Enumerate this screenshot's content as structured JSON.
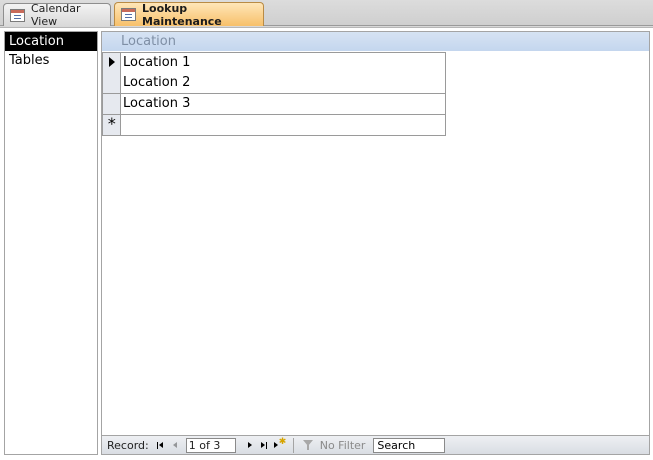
{
  "tabs": [
    {
      "label": "Calendar View",
      "active": false
    },
    {
      "label": "Lookup Maintenance",
      "active": true
    }
  ],
  "listbox": {
    "items": [
      "Location",
      "Tables"
    ],
    "selected_index": 0
  },
  "datasheet": {
    "column_header": "Location",
    "rows": [
      "Location 1",
      "Location 2",
      "Location 3"
    ],
    "new_row_marker": "*"
  },
  "navigator": {
    "label": "Record:",
    "position": "1 of 3",
    "filter_label": "No Filter",
    "search_label": "Search"
  },
  "colors": {
    "active_tab": "#f7c06a",
    "header_bg": "#c4d6ee",
    "selected_item_bg": "#000000"
  }
}
